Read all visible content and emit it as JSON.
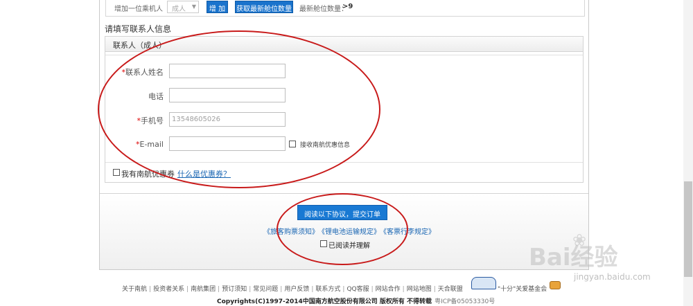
{
  "passenger_bar": {
    "add_label": "增加一位乘机人",
    "type_selected": "成人",
    "add_button": "增 加",
    "refresh_button": "获取最新舱位数量",
    "seat_count_label": "最新舱位数量：",
    "seat_count_value": ">9"
  },
  "section_title": "请填写联系人信息",
  "contact_panel": {
    "header": "联系人（成人）",
    "fields": {
      "name_label": "联系人姓名",
      "phone_label": "电话",
      "mobile_label": "手机号",
      "mobile_placeholder": "13548605026",
      "email_label": "E-mail",
      "offer_label": "接收南航优惠信息"
    },
    "required_mark": "*",
    "coupon_label": "我有南航优惠券",
    "coupon_link": "什么是优惠券？"
  },
  "submit": {
    "button": "阅读以下协议，提交订单",
    "rules": [
      "《旅客购票须知》",
      "《锂电池运输规定》",
      "《客票行李规定》"
    ],
    "agree_label": "已阅读并理解"
  },
  "footer": {
    "links": [
      "关于南航",
      "投资者关系",
      "南航集团",
      "预订须知",
      "常见问题",
      "用户反馈",
      "联系方式",
      "QQ客服",
      "网站合作",
      "网站地图",
      "天合联盟"
    ],
    "ten_love": "\"十分\"关爱基金会",
    "copyright": "Copyrights(C)1997-2014中国南方航空股份有限公司 版权所有 不得转载",
    "icp": "粤ICP备05053330号"
  },
  "watermark": {
    "brand": "Bai经验",
    "url": "jingyan.baidu.com"
  },
  "colors": {
    "button_blue": "#1a73cc",
    "annotation_red": "#c81a1a",
    "link_blue": "#1a66b3"
  }
}
